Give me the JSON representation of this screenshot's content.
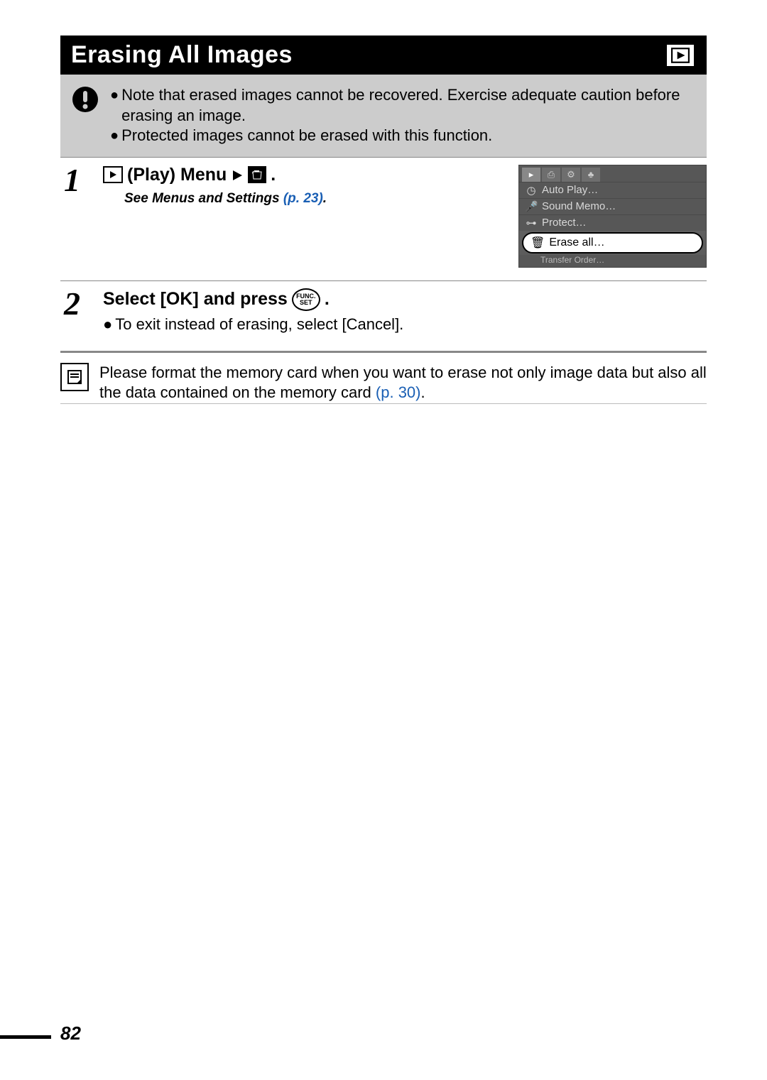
{
  "header": {
    "title": "Erasing All Images"
  },
  "caution": {
    "bullets": [
      "Note that erased images cannot be recovered. Exercise adequate caution before erasing an image.",
      "Protected images cannot be erased with this function."
    ]
  },
  "steps": {
    "s1": {
      "num": "1",
      "label_a": "(Play) Menu",
      "period": ".",
      "subnote_prefix": "See Menus and Settings ",
      "subnote_ref": "(p. 23)",
      "subnote_suffix": "."
    },
    "s2": {
      "num": "2",
      "label": "Select [OK] and press ",
      "period": " .",
      "body": "To exit instead of erasing, select [Cancel]."
    }
  },
  "camera_menu": {
    "items": {
      "auto_play": "Auto Play…",
      "sound_memo": "Sound Memo…",
      "protect": "Protect…",
      "erase_all": "Erase all…",
      "transfer": "Transfer Order…"
    }
  },
  "funcset": {
    "top": "FUNC.",
    "bottom": "SET"
  },
  "info": {
    "text_a": "Please format the memory card when you want to erase not only image data but also all the data contained on the memory card ",
    "ref": "(p. 30)",
    "suffix": "."
  },
  "page_number": "82"
}
